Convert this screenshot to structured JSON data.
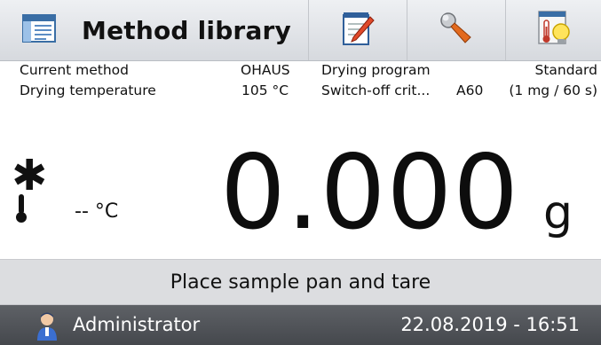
{
  "header": {
    "title": "Method library",
    "icons": {
      "library": "method-library-icon",
      "edit": "edit-notepad-icon",
      "tools": "wrench-icon",
      "info": "thermometer-bulb-info-icon"
    }
  },
  "info": {
    "current_method_label": "Current method",
    "current_method_value": "OHAUS",
    "drying_program_label": "Drying program",
    "drying_program_value": "Standard",
    "drying_temperature_label": "Drying temperature",
    "drying_temperature_value": "105 °C",
    "switch_off_label": "Switch-off crit...",
    "switch_off_code": "A60",
    "switch_off_value": "(1 mg / 60 s)"
  },
  "reading": {
    "status_symbol": "✱",
    "temperature": "-- °C",
    "weight": "0.000",
    "unit": "g"
  },
  "status": {
    "message": "Place sample pan and tare"
  },
  "footer": {
    "user": "Administrator",
    "datetime": "22.08.2019 - 16:51"
  },
  "colors": {
    "topbar": "#d6d9de",
    "statusbar": "#dcdde0",
    "footer": "#45484d"
  }
}
